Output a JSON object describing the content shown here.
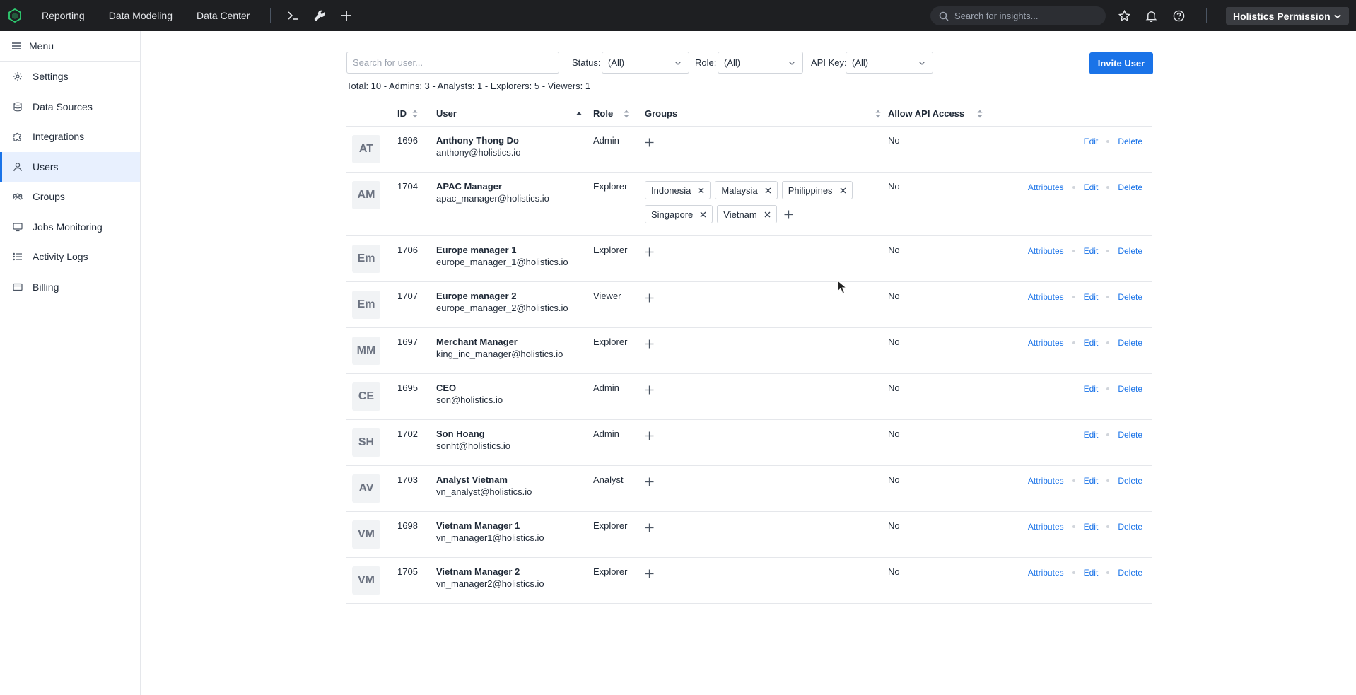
{
  "topbar": {
    "nav": [
      "Reporting",
      "Data Modeling",
      "Data Center"
    ],
    "search_placeholder": "Search for insights...",
    "workspace": "Holistics Permission"
  },
  "sidebar": {
    "menu_label": "Menu",
    "items": [
      {
        "label": "Settings",
        "icon": "gear-icon"
      },
      {
        "label": "Data Sources",
        "icon": "database-icon"
      },
      {
        "label": "Integrations",
        "icon": "puzzle-icon"
      },
      {
        "label": "Users",
        "icon": "user-icon",
        "active": true
      },
      {
        "label": "Groups",
        "icon": "group-icon"
      },
      {
        "label": "Jobs Monitoring",
        "icon": "monitor-icon"
      },
      {
        "label": "Activity Logs",
        "icon": "list-icon"
      },
      {
        "label": "Billing",
        "icon": "credit-card-icon"
      }
    ]
  },
  "filters": {
    "search_placeholder": "Search for user...",
    "status_label": "Status:",
    "status_value": "(All)",
    "role_label": "Role:",
    "role_value": "(All)",
    "apikey_label": "API Key:",
    "apikey_value": "(All)",
    "invite_label": "Invite User"
  },
  "totals": "Total: 10 - Admins: 3 - Analysts: 1 - Explorers: 5 - Viewers: 1",
  "table": {
    "headers": {
      "id": "ID",
      "user": "User",
      "role": "Role",
      "groups": "Groups",
      "api": "Allow API Access"
    },
    "actions": {
      "attributes": "Attributes",
      "edit": "Edit",
      "delete": "Delete"
    },
    "rows": [
      {
        "initials": "AT",
        "id": "1696",
        "name": "Anthony Thong Do",
        "email": "anthony@holistics.io",
        "role": "Admin",
        "groups": [],
        "api": "No",
        "attributes": false
      },
      {
        "initials": "AM",
        "id": "1704",
        "name": "APAC Manager",
        "email": "apac_manager@holistics.io",
        "role": "Explorer",
        "groups": [
          "Indonesia",
          "Malaysia",
          "Philippines",
          "Singapore",
          "Vietnam"
        ],
        "api": "No",
        "attributes": true
      },
      {
        "initials": "Em",
        "id": "1706",
        "name": "Europe manager 1",
        "email": "europe_manager_1@holistics.io",
        "role": "Explorer",
        "groups": [],
        "api": "No",
        "attributes": true
      },
      {
        "initials": "Em",
        "id": "1707",
        "name": "Europe manager 2",
        "email": "europe_manager_2@holistics.io",
        "role": "Viewer",
        "groups": [],
        "api": "No",
        "attributes": true
      },
      {
        "initials": "MM",
        "id": "1697",
        "name": "Merchant Manager",
        "email": "king_inc_manager@holistics.io",
        "role": "Explorer",
        "groups": [],
        "api": "No",
        "attributes": true
      },
      {
        "initials": "CE",
        "id": "1695",
        "name": "CEO",
        "email": "son@holistics.io",
        "role": "Admin",
        "groups": [],
        "api": "No",
        "attributes": false
      },
      {
        "initials": "SH",
        "id": "1702",
        "name": "Son Hoang",
        "email": "sonht@holistics.io",
        "role": "Admin",
        "groups": [],
        "api": "No",
        "attributes": false
      },
      {
        "initials": "AV",
        "id": "1703",
        "name": "Analyst Vietnam",
        "email": "vn_analyst@holistics.io",
        "role": "Analyst",
        "groups": [],
        "api": "No",
        "attributes": true
      },
      {
        "initials": "VM",
        "id": "1698",
        "name": "Vietnam Manager 1",
        "email": "vn_manager1@holistics.io",
        "role": "Explorer",
        "groups": [],
        "api": "No",
        "attributes": true
      },
      {
        "initials": "VM",
        "id": "1705",
        "name": "Vietnam Manager 2",
        "email": "vn_manager2@holistics.io",
        "role": "Explorer",
        "groups": [],
        "api": "No",
        "attributes": true
      }
    ]
  }
}
